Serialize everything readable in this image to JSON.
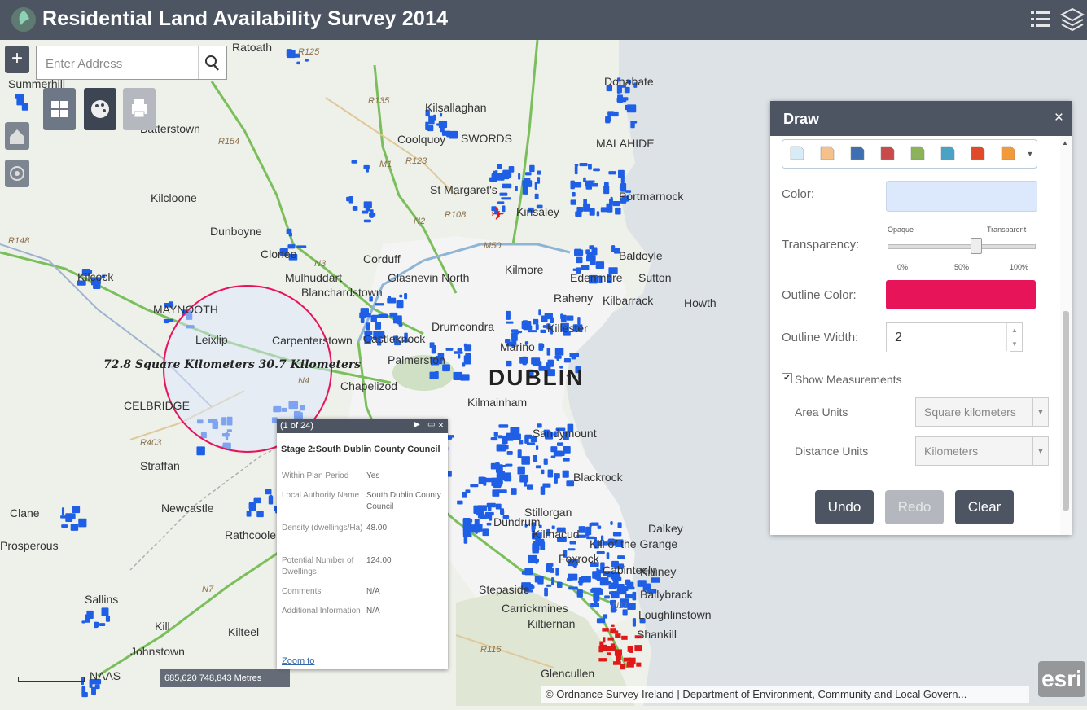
{
  "app": {
    "title": "Residential Land Availability Survey 2014"
  },
  "search": {
    "placeholder": "Enter Address"
  },
  "map": {
    "towns": [
      {
        "name": "Summerhill",
        "cls": "town"
      },
      {
        "name": "Ratoath",
        "cls": "town"
      },
      {
        "name": "Donabate",
        "cls": "town"
      },
      {
        "name": "Kilsallaghan",
        "cls": "town"
      },
      {
        "name": "Batterstown",
        "cls": "town"
      },
      {
        "name": "Coolquoy",
        "cls": "town"
      },
      {
        "name": "SWORDS",
        "cls": "town"
      },
      {
        "name": "MALAHIDE",
        "cls": "town"
      },
      {
        "name": "Kilcloone",
        "cls": "town"
      },
      {
        "name": "St Margaret's",
        "cls": "town"
      },
      {
        "name": "Portmarnock",
        "cls": "town"
      },
      {
        "name": "Kinsaley",
        "cls": "town"
      },
      {
        "name": "Dunboyne",
        "cls": "town"
      },
      {
        "name": "Clonee",
        "cls": "town"
      },
      {
        "name": "Corduff",
        "cls": "town"
      },
      {
        "name": "Baldoyle",
        "cls": "town"
      },
      {
        "name": "Kilcock",
        "cls": "town"
      },
      {
        "name": "Mulhuddart",
        "cls": "town"
      },
      {
        "name": "Glasnevin North",
        "cls": "town"
      },
      {
        "name": "Kilmore",
        "cls": "town"
      },
      {
        "name": "Edenmore",
        "cls": "town"
      },
      {
        "name": "Sutton",
        "cls": "town"
      },
      {
        "name": "MAYNOOTH",
        "cls": "town"
      },
      {
        "name": "Blanchardstown",
        "cls": "town"
      },
      {
        "name": "Raheny",
        "cls": "town"
      },
      {
        "name": "Kilbarrack",
        "cls": "town"
      },
      {
        "name": "Howth",
        "cls": "town"
      },
      {
        "name": "Leixlip",
        "cls": "town"
      },
      {
        "name": "Carpenterstown",
        "cls": "town"
      },
      {
        "name": "Castleknock",
        "cls": "town"
      },
      {
        "name": "Killester",
        "cls": "town"
      },
      {
        "name": "Drumcondra",
        "cls": "town"
      },
      {
        "name": "Palmerston",
        "cls": "town"
      },
      {
        "name": "Marino",
        "cls": "town"
      },
      {
        "name": "Chapelizod",
        "cls": "town"
      },
      {
        "name": "DUBLIN",
        "cls": "city"
      },
      {
        "name": "CELBRIDGE",
        "cls": "town"
      },
      {
        "name": "Kilmainham",
        "cls": "town"
      },
      {
        "name": "Sandymount",
        "cls": "town"
      },
      {
        "name": "Straffan",
        "cls": "town"
      },
      {
        "name": "Blackrock",
        "cls": "town"
      },
      {
        "name": "Clane",
        "cls": "town"
      },
      {
        "name": "Newcastle",
        "cls": "town"
      },
      {
        "name": "Stillorgan",
        "cls": "town"
      },
      {
        "name": "Dalkey",
        "cls": "town"
      },
      {
        "name": "Rathcoole",
        "cls": "town"
      },
      {
        "name": "Dundrum",
        "cls": "town"
      },
      {
        "name": "Kilmacud",
        "cls": "town"
      },
      {
        "name": "Kill of the Grange",
        "cls": "town"
      },
      {
        "name": "Prosperous",
        "cls": "town"
      },
      {
        "name": "Foxrock",
        "cls": "town"
      },
      {
        "name": "Killiney",
        "cls": "town"
      },
      {
        "name": "Stepaside",
        "cls": "town"
      },
      {
        "name": "Cabinteely",
        "cls": "town"
      },
      {
        "name": "Ballybrack",
        "cls": "town"
      },
      {
        "name": "Sallins",
        "cls": "town"
      },
      {
        "name": "Carrickmines",
        "cls": "town"
      },
      {
        "name": "Loughlinstown",
        "cls": "town"
      },
      {
        "name": "Kill",
        "cls": "town"
      },
      {
        "name": "Kilteel",
        "cls": "town"
      },
      {
        "name": "Kiltiernan",
        "cls": "town"
      },
      {
        "name": "Shankill",
        "cls": "town"
      },
      {
        "name": "Johnstown",
        "cls": "town"
      },
      {
        "name": "NAAS",
        "cls": "town"
      },
      {
        "name": "Glencullen",
        "cls": "town"
      }
    ],
    "roads": [
      "R125",
      "R135",
      "R154",
      "R123",
      "R108",
      "R148",
      "R403",
      "R116",
      "M1",
      "N2",
      "N3",
      "M50",
      "N4",
      "N7",
      "N11"
    ],
    "measurement_text": "72.8 Square Kilometers 30.7 Kilometers",
    "scale_label": "",
    "coordinates": "685,620 748,843 Metres",
    "attribution": "© Ordnance Survey Ireland | Department of Environment, Community and Local Govern...",
    "esri_logo": "esri"
  },
  "draw_panel": {
    "title": "Draw",
    "close_label": "×",
    "color_label": "Color:",
    "transparency_label": "Transparency:",
    "opaque_label": "Opaque",
    "transparent_label": "Transparent",
    "tick_labels": [
      "0%",
      "50%",
      "100%"
    ],
    "transparency_value": 0.6,
    "outline_color_label": "Outline Color:",
    "outline_width_label": "Outline Width:",
    "outline_width_value": "2",
    "show_measurements_label": "Show Measurements",
    "show_measurements_checked": true,
    "area_units_label": "Area Units",
    "area_units_value": "Square kilometers",
    "distance_units_label": "Distance Units",
    "distance_units_value": "Kilometers",
    "undo_label": "Undo",
    "redo_label": "Redo",
    "clear_label": "Clear",
    "fill_color": "#dce8fb",
    "outline_color": "#e8145a",
    "swatch_colors": [
      "#d8ecf8",
      "#f6c08a",
      "#3f6fb0",
      "#c94a4a",
      "#8db35a",
      "#4aa3c4",
      "#e04a2a",
      "#f29a3a"
    ]
  },
  "popup": {
    "counter": "(1 of 24)",
    "title": "Stage 2:South Dublin County Council",
    "fields": [
      {
        "key": "Within Plan Period",
        "value": "Yes"
      },
      {
        "key": "Local Authority Name",
        "value": "South Dublin County Council"
      },
      {
        "key": "Density (dwellings/Ha)",
        "value": "48.00"
      },
      {
        "key": "Potential Number of Dwellings",
        "value": "124.00"
      },
      {
        "key": "Comments",
        "value": "N/A"
      },
      {
        "key": "Additional Information",
        "value": "N/A"
      }
    ],
    "zoom_label": "Zoom to"
  },
  "colors": {
    "header": "#4d5563",
    "parcel_blue": "#1f5fe6",
    "parcel_red": "#e01818",
    "circle_outline": "#e8145a"
  }
}
